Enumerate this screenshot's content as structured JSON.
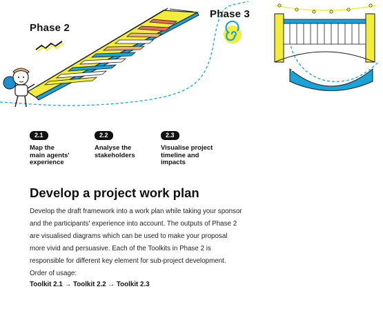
{
  "illustration": {
    "phase2_title": "Phase 2",
    "phase3_title": "Phase 3",
    "colors": {
      "accent_yellow": "#f2ec3a",
      "accent_blue": "#1aa3d9",
      "stair_red": "#e86a5c",
      "stair_tan": "#e8b27a",
      "character_blue": "#1c8fd0"
    }
  },
  "toolkits": [
    {
      "badge": "2.1",
      "label": "Map the\nmain agents'\nexperience"
    },
    {
      "badge": "2.2",
      "label": "Analyse the\nstakeholders"
    },
    {
      "badge": "2.3",
      "label": "Visualise project\ntimeline and\nimpacts"
    }
  ],
  "section": {
    "heading": "Develop a project work plan",
    "body": "Develop the draft framework into a work plan while taking your sponsor and the participants' experience into account. The outputs of Phase 2 are visualised diagrams which can be used to make your proposal more vivid and persuasive. Each of the Toolkits in Phase 2 is responsible for different key element for sub-project development. Order of usage:",
    "order": "Toolkit 2.1 → Toolkit 2.2 → Toolkit 2.3"
  }
}
